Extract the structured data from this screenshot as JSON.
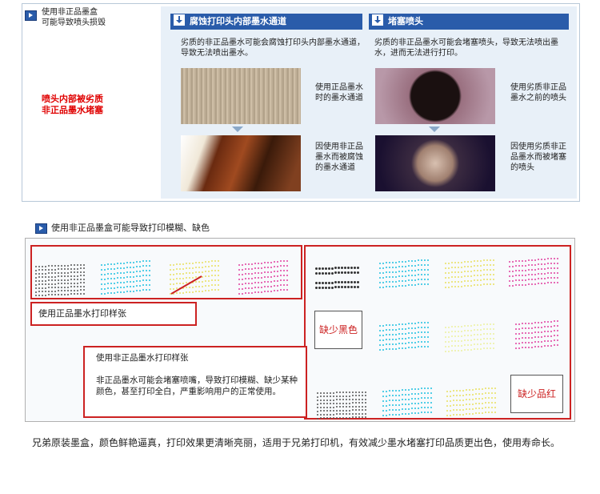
{
  "panel1": {
    "side_line1": "使用非正品墨盒",
    "side_line2": "可能导致喷头损毁",
    "red_line1": "喷头内部被劣质",
    "red_line2": "非正品墨水堵塞",
    "col1": {
      "header": "腐蚀打印头内部墨水通道",
      "desc": "劣质的非正品墨水可能会腐蚀打印头内部墨水通道，导致无法喷出墨水。",
      "cap1": "使用正品墨水时的墨水通道",
      "cap2": "因使用非正品墨水而被腐蚀的墨水通道"
    },
    "col2": {
      "header": "堵塞喷头",
      "desc": "劣质的非正品墨水可能会堵塞喷头，导致无法喷出墨水，进而无法进行打印。",
      "cap1": "使用劣质非正品墨水之前的喷头",
      "cap2": "因使用劣质非正品墨水而被堵塞的喷头"
    }
  },
  "panel2": {
    "heading": "使用非正品墨盒可能导致打印模糊、缺色",
    "label_genuine": "使用正品墨水打印样张",
    "label_fake_title": "使用非正品墨水打印样张",
    "label_fake_desc": "非正品墨水可能会堵塞喷嘴，导致打印模糊、缺少某种颜色，甚至打印全白，严重影响用户的正常使用。",
    "label_missing_black": "缺少黑色",
    "label_missing_magenta": "缺少品红"
  },
  "footer": {
    "text": "兄弟原装墨盒，颜色鲜艳逼真，打印效果更清晰亮丽，适用于兄弟打印机，有效减少墨水堵塞打印品质更出色，使用寿命长。"
  },
  "colors": {
    "blue": "#2a5caa",
    "red": "#cc2222",
    "cyan": "#20c0e0",
    "yellow": "#e8e060",
    "magenta": "#e040a0"
  }
}
